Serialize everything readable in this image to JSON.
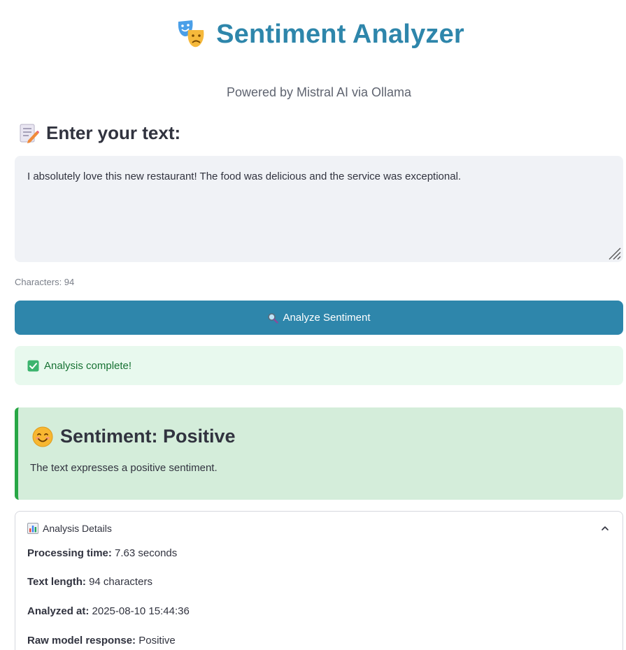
{
  "header": {
    "title": "Sentiment Analyzer",
    "title_icon": "performing-arts-masks-icon",
    "subtitle": "Powered by Mistral AI via Ollama",
    "accent_color": "#2e86ab"
  },
  "input_section": {
    "heading": "Enter your text:",
    "heading_icon": "memo-icon",
    "text_value": "I absolutely love this new restaurant! The food was delicious and the service was exceptional.",
    "char_count_label": "Characters: 94"
  },
  "analyze_button": {
    "label": "Analyze Sentiment",
    "icon": "magnifying-glass-icon",
    "color": "#2e86ab"
  },
  "success_alert": {
    "text": "Analysis complete!",
    "icon": "check-box-icon"
  },
  "result": {
    "title": "Sentiment: Positive",
    "icon": "smiling-face-icon",
    "description": "The text expresses a positive sentiment.",
    "background_color": "#d4edda",
    "border_color": "#28a745"
  },
  "details": {
    "title": "Analysis Details",
    "icon": "bar-chart-icon",
    "expanded": true,
    "rows": [
      {
        "label": "Processing time:",
        "value": "7.63 seconds"
      },
      {
        "label": "Text length:",
        "value": "94 characters"
      },
      {
        "label": "Analyzed at:",
        "value": "2025-08-10 15:44:36"
      },
      {
        "label": "Raw model response:",
        "value": "Positive"
      }
    ]
  }
}
